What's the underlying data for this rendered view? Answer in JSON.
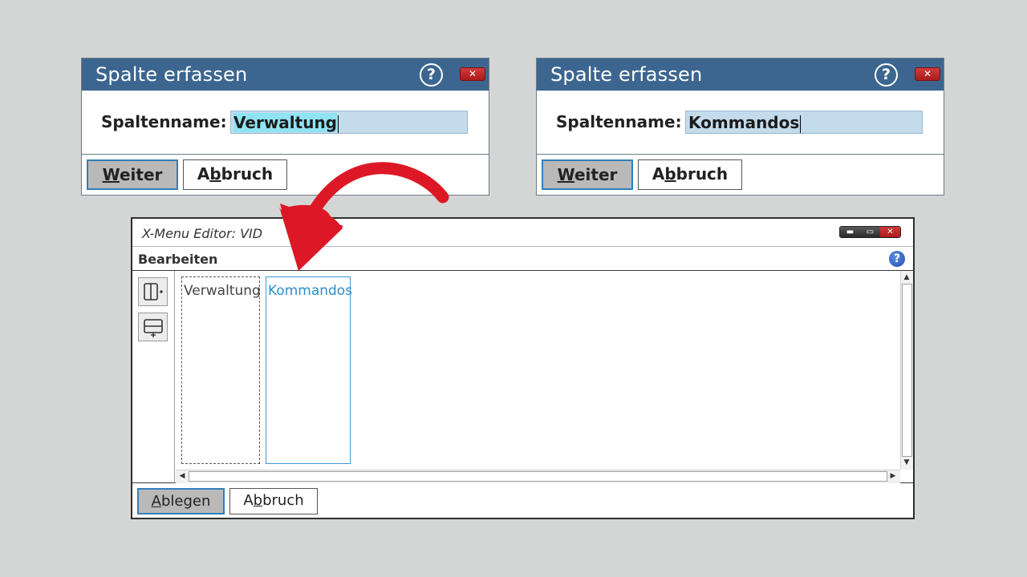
{
  "dialog_left": {
    "title": "Spalte erfassen",
    "help_glyph": "?",
    "close_glyph": "✕",
    "label": "Spaltenname:",
    "input_value": "Verwaltung",
    "buttons": {
      "next": {
        "pre": "",
        "accel": "W",
        "post": "eiter"
      },
      "cancel": {
        "pre": "A",
        "accel": "b",
        "post": "bruch"
      }
    }
  },
  "dialog_right": {
    "title": "Spalte erfassen",
    "help_glyph": "?",
    "close_glyph": "✕",
    "label": "Spaltenname:",
    "input_value": "Kommandos",
    "buttons": {
      "next": {
        "pre": "",
        "accel": "W",
        "post": "eiter"
      },
      "cancel": {
        "pre": "A",
        "accel": "b",
        "post": "bruch"
      }
    }
  },
  "editor": {
    "title": "X-Menu Editor: VID",
    "window_controls": {
      "minimize": "▬",
      "maximize": "▭",
      "close": "✕"
    },
    "menu": "Bearbeiten",
    "help_glyph": "?",
    "toolbar": [
      {
        "icon": "add-column-icon"
      },
      {
        "icon": "add-row-icon"
      }
    ],
    "columns": [
      {
        "label": "Verwaltung",
        "state": "placeholder"
      },
      {
        "label": "Kommandos",
        "state": "selected"
      }
    ],
    "buttons": {
      "place": {
        "pre": "",
        "accel": "A",
        "post": "blegen"
      },
      "cancel": {
        "pre": "A",
        "accel": "b",
        "post": "bruch"
      }
    }
  },
  "colors": {
    "dialog_title_bg": "#3c6690",
    "close_red": "#c22a2a",
    "input_bg": "#c3dbeb",
    "selection_bg": "#8fe3f3",
    "primary_button_border": "#2f7fbd",
    "arrow": "#dd1826",
    "selected_column": "#2a8fca"
  }
}
